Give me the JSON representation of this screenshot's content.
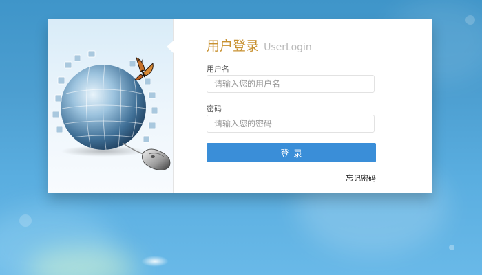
{
  "login": {
    "title_cn": "用户登录",
    "title_en": "UserLogin",
    "username_label": "用户名",
    "username_placeholder": "请输入您的用户名",
    "password_label": "密码",
    "password_placeholder": "请输入您的密码",
    "submit_label": "登录",
    "forgot_password_label": "忘记密码"
  },
  "illustration": {
    "icons": [
      "puzzle-globe-icon",
      "butterfly-icon",
      "computer-mouse-icon"
    ]
  },
  "colors": {
    "background": "#4d9fd1",
    "title_accent": "#c89130",
    "button": "#3a8ed8"
  }
}
